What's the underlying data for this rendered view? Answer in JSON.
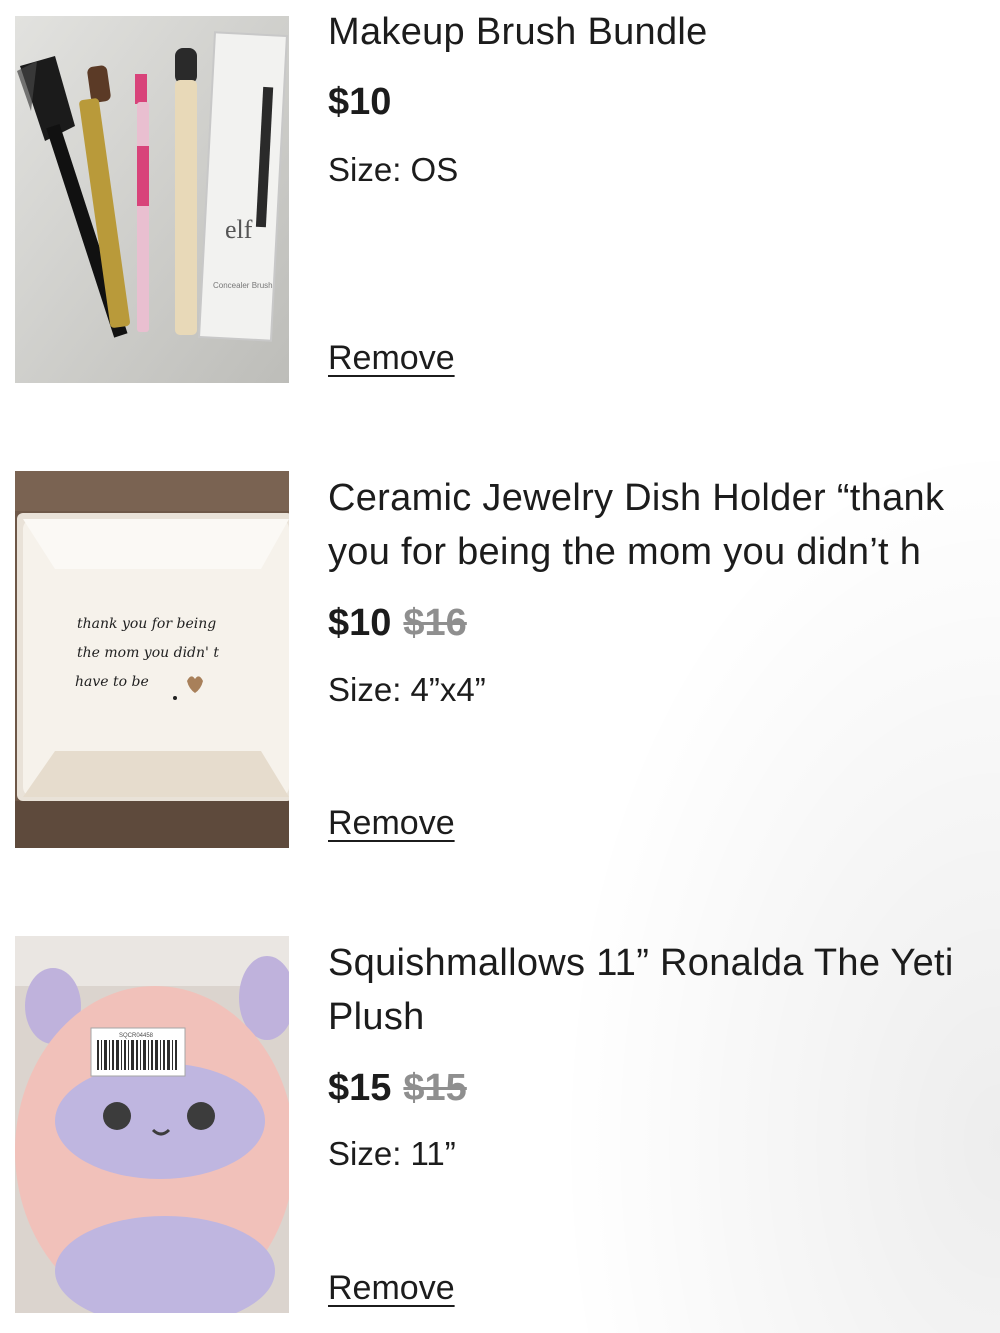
{
  "cart": {
    "items": [
      {
        "image": "makeup-brushes-photo",
        "title_lines": [
          "Makeup Brush Bundle"
        ],
        "price": "$10",
        "original_price": "",
        "size": "Size: OS",
        "remove_label": "Remove",
        "image_text": {
          "brand": "elf",
          "package": "Concealer Brush"
        }
      },
      {
        "image": "jewelry-dish-photo",
        "title_lines": [
          "Ceramic Jewelry Dish Holder “thank",
          "you for being the mom you didn’t h"
        ],
        "price": "$10",
        "original_price": "$16",
        "size": "Size: 4”x4”",
        "remove_label": "Remove",
        "image_text": {
          "line1": "thank you for being",
          "line2": "the mom you didn' t",
          "line3": "have to be"
        }
      },
      {
        "image": "squishmallow-yeti-photo",
        "title_lines": [
          "Squishmallows 11” Ronalda The Yeti",
          "Plush"
        ],
        "price": "$15",
        "original_price": "$15",
        "size": "Size: 11”",
        "remove_label": "Remove",
        "image_text": {
          "tag": "SQCR04458"
        }
      }
    ]
  },
  "colors": {
    "text": "#1c1c1c",
    "strikethrough": "#8f8f8f"
  }
}
